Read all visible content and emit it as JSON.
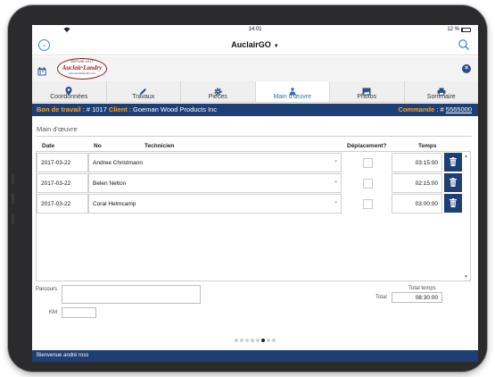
{
  "status": {
    "time": "14:01",
    "battery": "12 %",
    "battery_level": 0.12
  },
  "app": {
    "title": "AuclairGO"
  },
  "logo": {
    "top_text": "DEPUIS 1917",
    "name": "Auclair·Landry",
    "url": "www.auclairlandry.com"
  },
  "tabs": [
    {
      "label": "Coordonnées",
      "icon": "map-pin-icon"
    },
    {
      "label": "Travaux",
      "icon": "pencil-icon"
    },
    {
      "label": "Pièces",
      "icon": "gear-icon"
    },
    {
      "label": "Main d'œuvre",
      "icon": "worker-icon",
      "active": true
    },
    {
      "label": "Photos",
      "icon": "image-icon"
    },
    {
      "label": "Sommaire",
      "icon": "printer-icon"
    }
  ],
  "work_order": {
    "label": "Bon de travail",
    "number": "# 1017",
    "client_label": "Client",
    "client": "Goeman Wood Products Inc",
    "order_label": "Commande",
    "order_number": "5565000"
  },
  "section": {
    "title": "Main d'œuvre"
  },
  "columns": {
    "date": "Date",
    "no": "No",
    "tech": "Technicien",
    "travel": "Déplacement?",
    "time": "Temps"
  },
  "rows": [
    {
      "date": "2017-03-22",
      "tech": "Andree Christmann",
      "travel": false,
      "time": "03:15:00"
    },
    {
      "date": "2017-03-22",
      "tech": "Belen Nelton",
      "travel": false,
      "time": "02:15:00"
    },
    {
      "date": "2017-03-22",
      "tech": "Coral Helmcamp",
      "travel": false,
      "time": "03:00:00"
    }
  ],
  "form": {
    "route_label": "Parcours",
    "km_label": "KM",
    "route_value": "",
    "km_value": ""
  },
  "totals": {
    "header": "Total temps",
    "label": "Total",
    "value": "08:30:00"
  },
  "pager": {
    "count": 8,
    "active": 5
  },
  "footer": {
    "welcome": "Bienvenue andré ross"
  },
  "colors": {
    "brand_navy": "#1e3f73",
    "accent_orange": "#f5a623",
    "link_blue": "#2e6fb8"
  }
}
